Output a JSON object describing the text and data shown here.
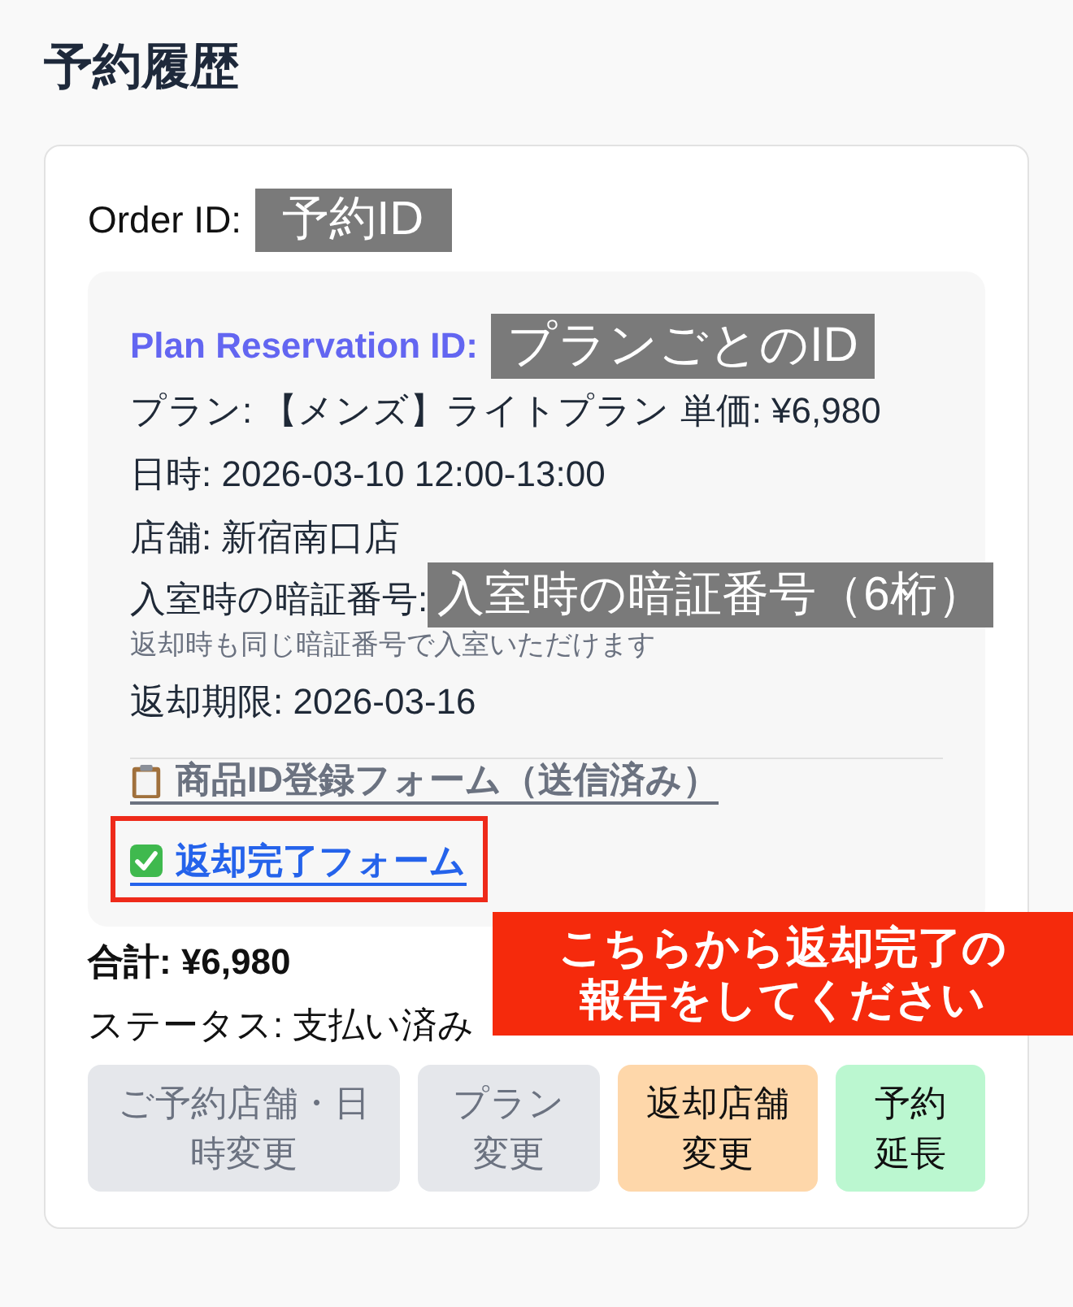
{
  "title": "予約履歴",
  "order": {
    "id_label": "Order ID:",
    "id_redaction": "予約ID",
    "plan_reservation": {
      "id_label": "Plan Reservation ID:",
      "id_redaction": "プランごとのID",
      "plan": "プラン: 【メンズ】ライトプラン 単価: ¥6,980",
      "datetime": "日時: 2026-03-10 12:00-13:00",
      "store": "店舗: 新宿南口店",
      "pin_label": "入室時の暗証番号:",
      "pin_redaction": "入室時の暗証番号（6桁）",
      "pin_note": "返却時も同じ暗証番号で入室いただけます",
      "return_deadline": "返却期限: 2026-03-16",
      "forms": [
        {
          "label": "商品ID登録フォーム（送信済み）",
          "kind": "submitted",
          "highlighted": false
        },
        {
          "label": "返却完了フォーム",
          "kind": "pending",
          "highlighted": true
        }
      ]
    },
    "total": "合計: ¥6,980",
    "status": "ステータス: 支払い済み",
    "buttons": [
      {
        "label": "ご予約店舗・日時変更",
        "disabled": true,
        "color": "#e5e7eb"
      },
      {
        "label": "プラン変更",
        "disabled": true,
        "color": "#e5e7eb"
      },
      {
        "label": "返却店舗変更",
        "disabled": false,
        "color": "#fed7aa"
      },
      {
        "label": "予約延長",
        "disabled": false,
        "color": "#bbf7d0"
      }
    ]
  },
  "callout": {
    "lines": [
      "こちらから返却完了の",
      "報告をしてください"
    ]
  }
}
